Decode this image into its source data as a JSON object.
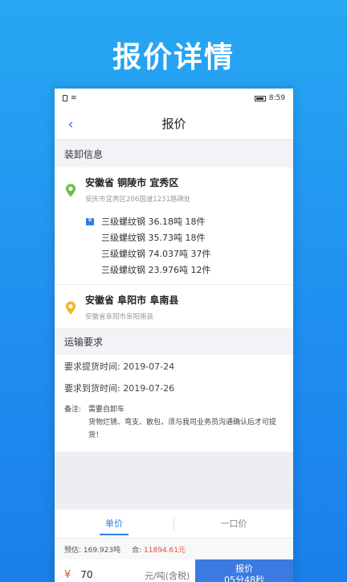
{
  "promo": {
    "title": "报价详情"
  },
  "status": {
    "time": "8:59"
  },
  "nav": {
    "title": "报价"
  },
  "loading_section": {
    "title": "装卸信息",
    "origin": {
      "main": "安徽省 铜陵市 宜秀区",
      "sub": "安庆市宜秀区206国道1231路碑处"
    },
    "goods": [
      {
        "name": "三级螺纹钢",
        "weight": "36.18吨",
        "count": "18件"
      },
      {
        "name": "三级螺纹钢",
        "weight": "35.73吨",
        "count": "18件"
      },
      {
        "name": "三级螺纹钢",
        "weight": "74.037吨",
        "count": "37件"
      },
      {
        "name": "三级螺纹钢",
        "weight": "23.976吨",
        "count": "12件"
      }
    ],
    "destination": {
      "main": "安徽省 阜阳市 阜南县",
      "sub": "安徽省阜阳市阜阳南县"
    }
  },
  "transport_section": {
    "title": "运输要求",
    "pickup": "要求提货时间: 2019-07-24",
    "arrival": "要求到货时间: 2019-07-26",
    "note_label": "备注:",
    "note_text": "需要自卸车\n货物烂锈、弯支、散包，须与我司业务员沟通确认后才可提货！"
  },
  "tabs": [
    {
      "label": "单价"
    },
    {
      "label": "一口价"
    }
  ],
  "summary": {
    "estimate": "预估: 169.923吨",
    "total_label": "合:",
    "total_value": "11894.61元"
  },
  "bottom": {
    "currency": "¥",
    "price_value": "70",
    "unit": "元/吨(含税)",
    "quote_label": "报价",
    "countdown": "05分48秒"
  },
  "colors": {
    "accent": "#2f7de1",
    "origin_pin": "#6cc04a",
    "dest_pin": "#f2b52b",
    "amount": "#e84b3c"
  }
}
